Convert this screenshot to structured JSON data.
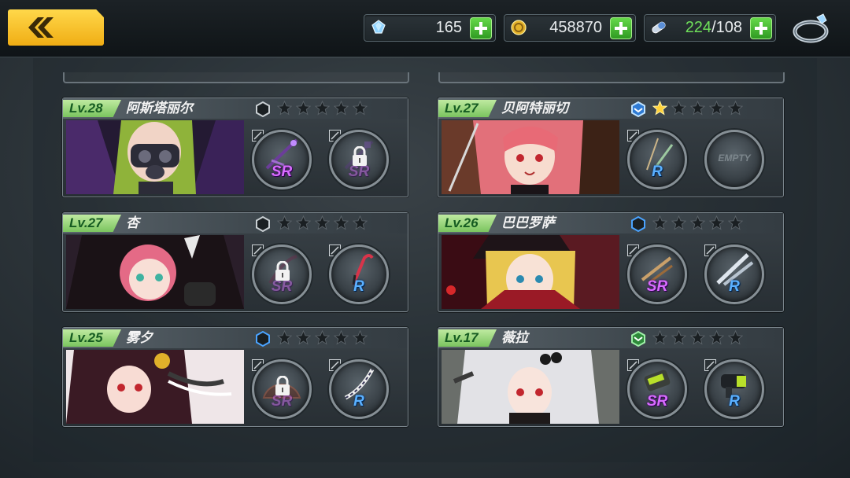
{
  "resources": {
    "gems": "165",
    "gold": "458870",
    "stamina_current": "224",
    "stamina_sep_max": "/108"
  },
  "empty_label": "EMPTY",
  "cards": [
    {
      "level": "Lv.28",
      "name": "阿斯塔丽尔",
      "rank": "dark",
      "stars_lit": 0,
      "slot1": "SR",
      "slot2": "SR",
      "slot2_locked": true
    },
    {
      "level": "Lv.27",
      "name": "贝阿特丽切",
      "rank": "blue",
      "stars_lit": 1,
      "slot1": "R",
      "slot2": "",
      "slot2_empty": true
    },
    {
      "level": "Lv.27",
      "name": "杏",
      "rank": "dark",
      "stars_lit": 0,
      "slot1": "SR",
      "slot1_locked": true,
      "slot2": "R"
    },
    {
      "level": "Lv.26",
      "name": "巴巴罗萨",
      "rank": "blue-outline",
      "stars_lit": 0,
      "slot1": "SR",
      "slot2": "R"
    },
    {
      "level": "Lv.25",
      "name": "雾夕",
      "rank": "blue-outline",
      "stars_lit": 0,
      "slot1": "SR",
      "slot1_locked": true,
      "slot2": "R"
    },
    {
      "level": "Lv.17",
      "name": "薇拉",
      "rank": "green",
      "stars_lit": 0,
      "slot1": "SR",
      "slot2": "R"
    }
  ],
  "colors": {
    "level_tag": "#8fd36f",
    "sr": "#d86bff",
    "r": "#5ab0ff",
    "plus": "#4fc43a",
    "back": "#f5c21c"
  }
}
